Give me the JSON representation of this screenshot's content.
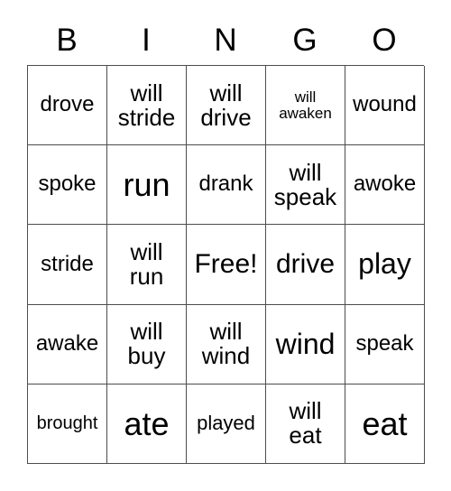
{
  "card": {
    "title": "BINGO",
    "free_space_label": "Free!",
    "header": {
      "letters": [
        "B",
        "I",
        "N",
        "G",
        "O"
      ]
    },
    "colors": {
      "background": "#ffffff",
      "text": "#000000",
      "grid_line": "#4d4d4d"
    },
    "grid": {
      "columns": 5,
      "rows": 5,
      "cells": [
        [
          {
            "text": "drove",
            "size": "fs-md"
          },
          {
            "text": "will\nstride",
            "size": "fs-two"
          },
          {
            "text": "will\ndrive",
            "size": "fs-two"
          },
          {
            "text": "will\nawaken",
            "size": "fs-xs"
          },
          {
            "text": "wound",
            "size": "fs-md"
          }
        ],
        [
          {
            "text": "spoke",
            "size": "fs-md"
          },
          {
            "text": "run",
            "size": "fs-xxl"
          },
          {
            "text": "drank",
            "size": "fs-md"
          },
          {
            "text": "will\nspeak",
            "size": "fs-two"
          },
          {
            "text": "awoke",
            "size": "fs-md"
          }
        ],
        [
          {
            "text": "stride",
            "size": "fs-md"
          },
          {
            "text": "will\nrun",
            "size": "fs-two"
          },
          {
            "text": "Free!",
            "size": "fs-lg"
          },
          {
            "text": "drive",
            "size": "fs-lg"
          },
          {
            "text": "play",
            "size": "fs-xl"
          }
        ],
        [
          {
            "text": "awake",
            "size": "fs-md"
          },
          {
            "text": "will\nbuy",
            "size": "fs-two"
          },
          {
            "text": "will\nwind",
            "size": "fs-two"
          },
          {
            "text": "wind",
            "size": "fs-xl"
          },
          {
            "text": "speak",
            "size": "fs-md"
          }
        ],
        [
          {
            "text": "brought",
            "size": "fs-sm"
          },
          {
            "text": "ate",
            "size": "fs-xxl"
          },
          {
            "text": "played",
            "size": "fs-smd"
          },
          {
            "text": "will\neat",
            "size": "fs-two"
          },
          {
            "text": "eat",
            "size": "fs-xxl"
          }
        ]
      ]
    }
  }
}
